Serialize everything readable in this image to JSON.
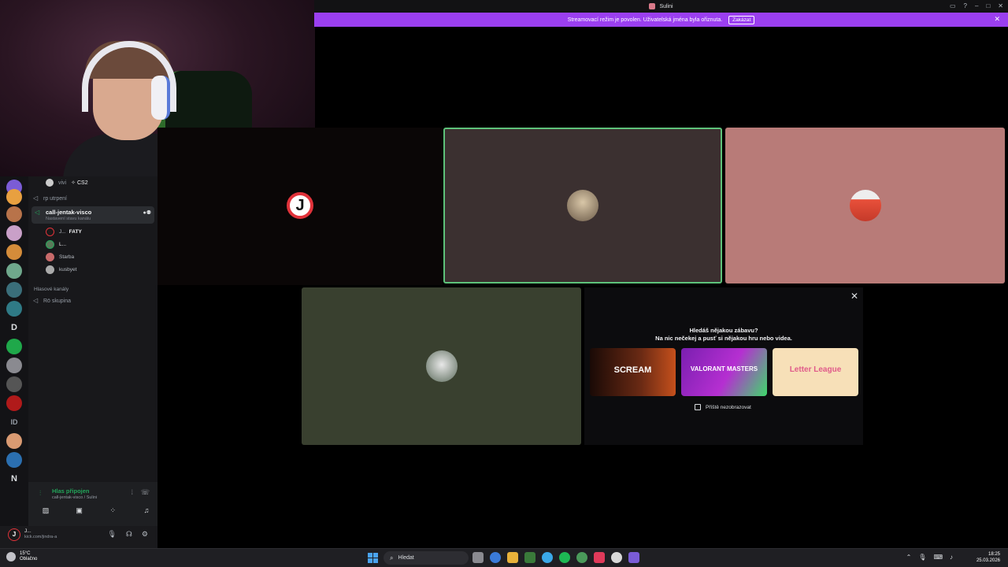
{
  "window": {
    "title": "Sulini"
  },
  "banner": {
    "text": "Streamovací režim je povolen. Uživatelská jména byla ořiznuta.",
    "button": "Zakázat"
  },
  "sidebar": {
    "top_member": {
      "name": "vivi",
      "status": "CS2"
    },
    "channel_rp": "rp utrpení",
    "active_channel": {
      "name": "call-jentak-visco",
      "status": "Nastavení stavu kanálu"
    },
    "members": [
      {
        "name": "J...",
        "tag": "FATY"
      },
      {
        "name": "L..."
      },
      {
        "name": "Starba"
      },
      {
        "name": "kusbyet"
      }
    ],
    "section": "Hlasové kanály",
    "voice_channel": "Rö skupina"
  },
  "server_icons": [
    "D",
    "ID",
    "N"
  ],
  "voice_panel": {
    "status": "Hlas připojen",
    "channel": "call-jentak-visco / Sulini"
  },
  "user_panel": {
    "name": "J...",
    "status": "kick.com/jindra-a"
  },
  "call": {
    "logo_letter": "J"
  },
  "activity": {
    "heading": "Hledáš nějakou zábavu?",
    "subheading": "Na nic nečekej a pusť si nějakou hru nebo videa.",
    "cards": [
      "SCREAM",
      "VALORANT MASTERS",
      "Letter League"
    ],
    "checkbox": "Příště nezobrazovat"
  },
  "taskbar": {
    "weather_temp": "15°C",
    "weather_desc": "Oblačno",
    "search": "Hledat",
    "time": "18:25",
    "date": "25.03.2026"
  },
  "colors": {
    "banner": "#9b3ff0",
    "online": "#23a55a",
    "accent_red": "#e0323a"
  }
}
